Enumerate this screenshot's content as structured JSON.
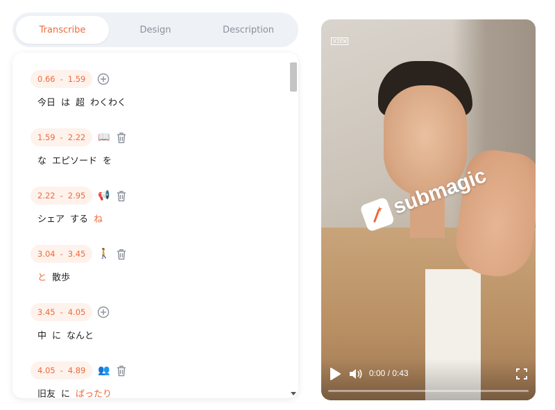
{
  "tabs": [
    {
      "label": "Transcribe",
      "active": true
    },
    {
      "label": "Design",
      "active": false
    },
    {
      "label": "Description",
      "active": false
    }
  ],
  "segments": [
    {
      "start": "0.66",
      "end": "1.59",
      "icon": "add-circle-icon",
      "emoji": "",
      "words": [
        {
          "text": "今日"
        },
        {
          "text": "は"
        },
        {
          "text": "超"
        },
        {
          "text": "わくわく"
        }
      ]
    },
    {
      "start": "1.59",
      "end": "2.22",
      "icon": "trash-icon",
      "emoji": "📖",
      "words": [
        {
          "text": "な"
        },
        {
          "text": "エピソード"
        },
        {
          "text": "を"
        }
      ]
    },
    {
      "start": "2.22",
      "end": "2.95",
      "icon": "trash-icon",
      "emoji": "📢",
      "words": [
        {
          "text": "シェア"
        },
        {
          "text": "する"
        },
        {
          "text": "ね",
          "highlight": true
        }
      ]
    },
    {
      "start": "3.04",
      "end": "3.45",
      "icon": "trash-icon",
      "emoji": "🚶",
      "words": [
        {
          "text": "と",
          "highlight": true
        },
        {
          "text": "散歩"
        }
      ]
    },
    {
      "start": "3.45",
      "end": "4.05",
      "icon": "add-circle-icon",
      "emoji": "",
      "words": [
        {
          "text": "中"
        },
        {
          "text": "に"
        },
        {
          "text": "なんと"
        }
      ]
    },
    {
      "start": "4.05",
      "end": "4.89",
      "icon": "trash-icon",
      "emoji": "👥",
      "words": [
        {
          "text": "旧友"
        },
        {
          "text": "に"
        },
        {
          "text": "ばったり",
          "highlight": true
        }
      ]
    }
  ],
  "time_separator": "-",
  "video": {
    "watermark": "VIEW",
    "brand": "submagic",
    "current_time": "0:00",
    "duration": "0:43",
    "time_display": "0:00 / 0:43",
    "progress": 0
  },
  "colors": {
    "accent": "#ee6a3a",
    "badge_bg": "#fef2ec",
    "tab_bg": "#eef2f7"
  }
}
